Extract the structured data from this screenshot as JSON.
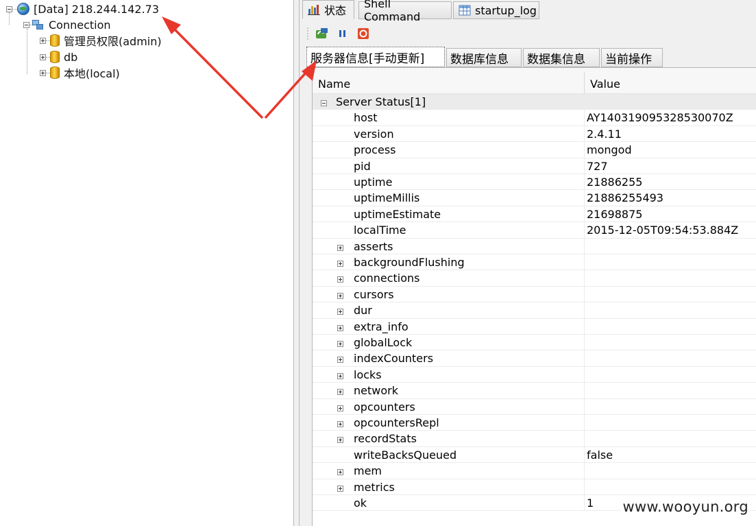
{
  "tree": {
    "root_label": "[Data]  218.244.142.73",
    "connection_label": "Connection",
    "databases": [
      "管理员权限(admin)",
      "db",
      "本地(local)"
    ]
  },
  "tabs": [
    {
      "label": "状态",
      "icon": "chart-icon"
    },
    {
      "label": "Shell Command",
      "icon": ""
    },
    {
      "label": "startup_log",
      "icon": "table-icon"
    }
  ],
  "toolbar": {
    "refresh_icon": "refresh-icon",
    "pause_icon": "pause-icon",
    "stop_icon": "stop-icon"
  },
  "subtabs": [
    "服务器信息[手动更新]",
    "数据库信息",
    "数据集信息",
    "当前操作"
  ],
  "grid": {
    "col_name": "Name",
    "col_value": "Value",
    "section_label": "Server Status[1]",
    "rows": [
      {
        "name": "host",
        "value": "AY140319095328530070Z",
        "expandable": false
      },
      {
        "name": "version",
        "value": "2.4.11",
        "expandable": false
      },
      {
        "name": "process",
        "value": "mongod",
        "expandable": false
      },
      {
        "name": "pid",
        "value": "727",
        "expandable": false
      },
      {
        "name": "uptime",
        "value": "21886255",
        "expandable": false
      },
      {
        "name": "uptimeMillis",
        "value": "21886255493",
        "expandable": false
      },
      {
        "name": "uptimeEstimate",
        "value": "21698875",
        "expandable": false
      },
      {
        "name": "localTime",
        "value": "2015-12-05T09:54:53.884Z",
        "expandable": false
      },
      {
        "name": "asserts",
        "value": "",
        "expandable": true
      },
      {
        "name": "backgroundFlushing",
        "value": "",
        "expandable": true
      },
      {
        "name": "connections",
        "value": "",
        "expandable": true
      },
      {
        "name": "cursors",
        "value": "",
        "expandable": true
      },
      {
        "name": "dur",
        "value": "",
        "expandable": true
      },
      {
        "name": "extra_info",
        "value": "",
        "expandable": true
      },
      {
        "name": "globalLock",
        "value": "",
        "expandable": true
      },
      {
        "name": "indexCounters",
        "value": "",
        "expandable": true
      },
      {
        "name": "locks",
        "value": "",
        "expandable": true
      },
      {
        "name": "network",
        "value": "",
        "expandable": true
      },
      {
        "name": "opcounters",
        "value": "",
        "expandable": true
      },
      {
        "name": "opcountersRepl",
        "value": "",
        "expandable": true
      },
      {
        "name": "recordStats",
        "value": "",
        "expandable": true
      },
      {
        "name": "writeBacksQueued",
        "value": "false",
        "expandable": false
      },
      {
        "name": "mem",
        "value": "",
        "expandable": true
      },
      {
        "name": "metrics",
        "value": "",
        "expandable": true
      },
      {
        "name": "ok",
        "value": "1",
        "expandable": false
      }
    ]
  },
  "watermark": "www.wooyun.org",
  "colors": {
    "arrow": "#e8372c",
    "section_bg": "#ebebeb"
  }
}
